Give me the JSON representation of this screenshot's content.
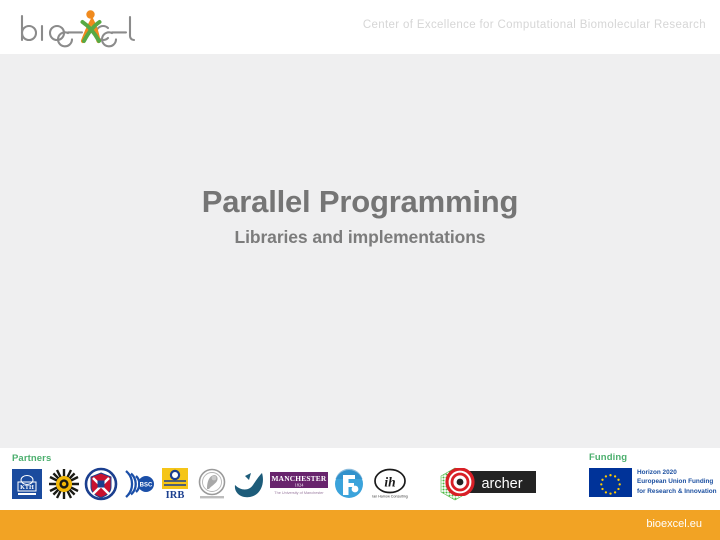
{
  "header": {
    "logo_text": "bioexcel",
    "logo_icon": "bioexcel-figure-icon",
    "tagline": "Center of Excellence for Computational Biomolecular Research"
  },
  "main": {
    "title": "Parallel Programming",
    "subtitle": "Libraries and implementations"
  },
  "footer": {
    "partners_label": "Partners",
    "funding_label": "Funding",
    "partners": [
      {
        "name": "KTH Royal Institute of Technology",
        "abbr": "KTH",
        "icon": "kth-logo-icon"
      },
      {
        "name": "KU Leuven sunburst",
        "abbr": "",
        "icon": "sunburst-logo-icon"
      },
      {
        "name": "The University of Edinburgh",
        "abbr": "",
        "icon": "edinburgh-crest-icon"
      },
      {
        "name": "Barcelona Supercomputing Center",
        "abbr": "BSC",
        "icon": "bsc-logo-icon"
      },
      {
        "name": "Institute for Research in Biomedicine",
        "abbr": "IRB",
        "icon": "irb-logo-icon"
      },
      {
        "name": "Max Planck Gesellschaft",
        "abbr": "",
        "icon": "max-planck-seal-icon"
      },
      {
        "name": "Forschungszentrum Juelich",
        "abbr": "",
        "icon": "juelich-swoosh-icon"
      },
      {
        "name": "The University of Manchester",
        "abbr": "MANCHESTER 1824",
        "icon": "manchester-logo-icon"
      },
      {
        "name": "Forschungsverbund",
        "abbr": "",
        "icon": "blue-circle-f-icon"
      },
      {
        "name": "Ian Harrow Consulting",
        "abbr": "ih",
        "icon": "ian-harrow-consulting-icon"
      },
      {
        "name": "Nostrum Biodiscovery",
        "abbr": "",
        "icon": "green-hexagon-grid-icon"
      }
    ],
    "archer": {
      "name": "ARCHER",
      "label": "archer",
      "icon": "archer-target-icon"
    },
    "funding": {
      "flag_icon": "eu-flag-icon",
      "line1": "Horizon 2020",
      "line2": "European Union Funding",
      "line3": "for Research & Innovation"
    }
  },
  "bottom_bar": {
    "url": "bioexcel.eu"
  },
  "colors": {
    "brand_orange": "#f2a324",
    "brand_green": "#4caf6e",
    "logo_gray": "#8b8b8b",
    "title_gray": "#757575",
    "body_bg": "#efeff0",
    "eu_blue": "#1b4fa0"
  }
}
